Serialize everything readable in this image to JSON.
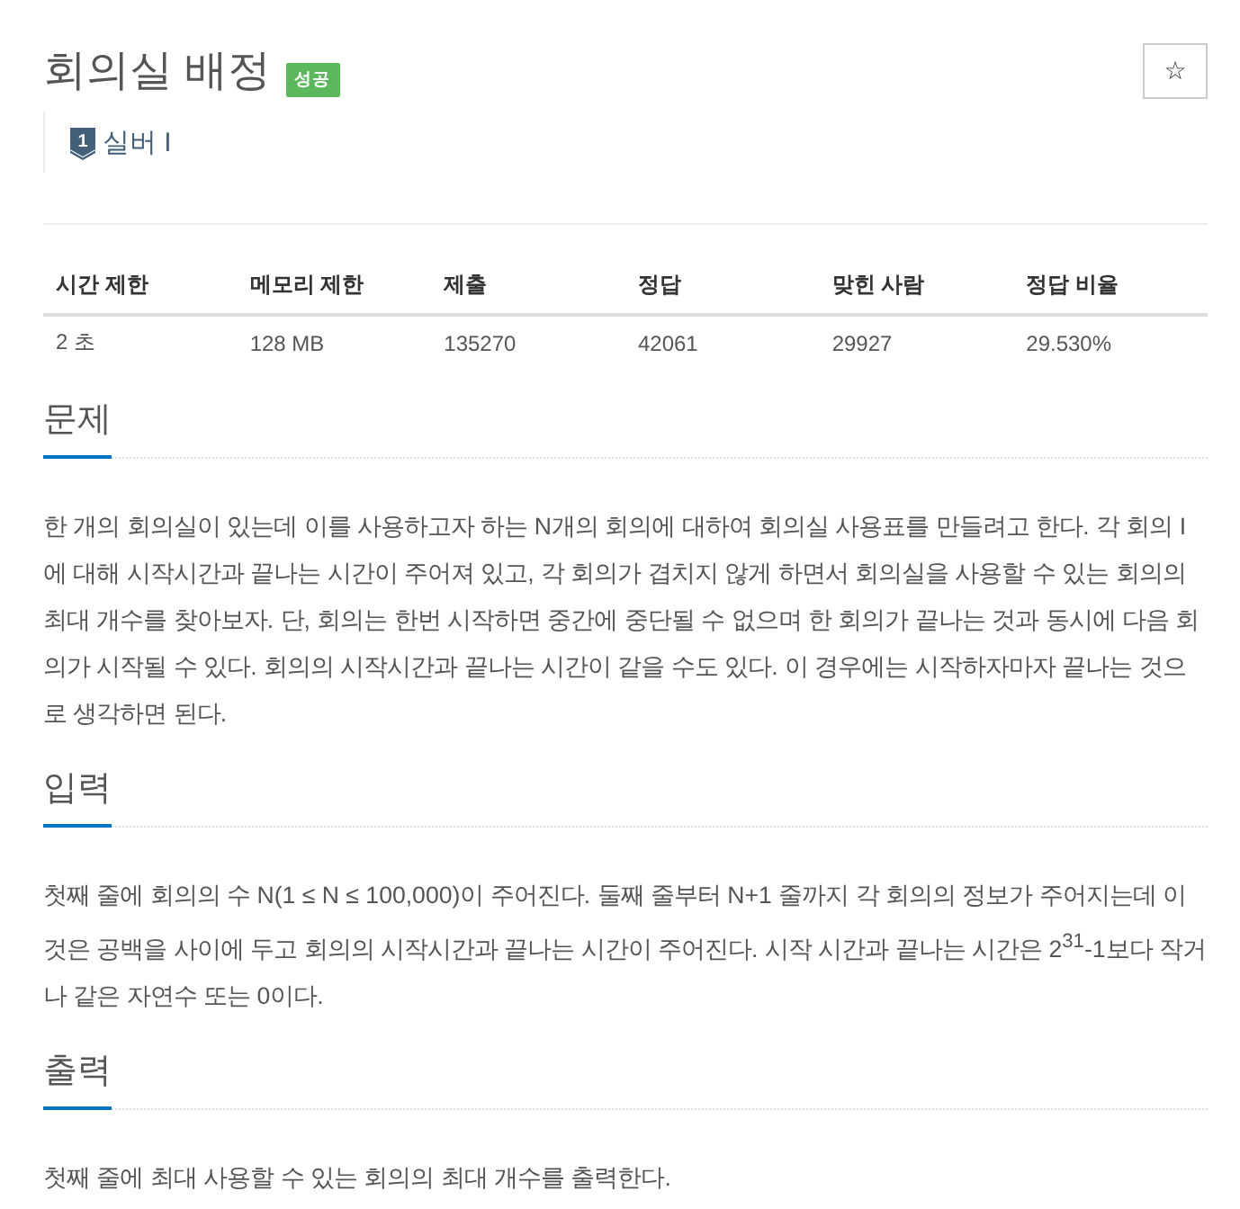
{
  "problem": {
    "title": "회의실 배정",
    "result_badge": {
      "label": "성공"
    },
    "favorite_button": {
      "label": "☆"
    },
    "tier": {
      "number": "1",
      "label": "실버 I"
    }
  },
  "limits_table": {
    "columns": [
      "시간 제한",
      "메모리 제한",
      "제출",
      "정답",
      "맞힌 사람",
      "정답 비율"
    ],
    "rows": [
      [
        "2 초",
        "128 MB",
        "135270",
        "42061",
        "29927",
        "29.530%"
      ]
    ]
  },
  "sections": [
    {
      "heading": "문제",
      "paragraph": "한 개의 회의실이 있는데 이를 사용하고자 하는 N개의 회의에 대하여 회의실 사용표를 만들려고 한다. 각 회의 I에 대해 시작시간과 끝나는 시간이 주어져 있고, 각 회의가 겹치지 않게 하면서 회의실을 사용할 수 있는 회의의 최대 개수를 찾아보자. 단, 회의는 한번 시작하면 중간에 중단될 수 없으며 한 회의가 끝나는 것과 동시에 다음 회의가 시작될 수 있다. 회의의 시작시간과 끝나는 시간이 같을 수도 있다. 이 경우에는 시작하자마자 끝나는 것으로 생각하면 된다."
    },
    {
      "heading": "입력",
      "paragraph": "첫째 줄에 회의의 수 N(1 ≤ N ≤ 100,000)이 주어진다. 둘째 줄부터 N+1 줄까지 각 회의의 정보가 주어지는데 이것은 공백을 사이에 두고 회의의 시작시간과 끝나는 시간이 주어진다. 시작 시간과 끝나는 시간은 2$^{31}$-1보다 작거나 같은 자연수 또는 0이다."
    },
    {
      "heading": "출력",
      "paragraph": "첫째 줄에 최대 사용할 수 있는 회의의 최대 개수를 출력한다."
    }
  ]
}
